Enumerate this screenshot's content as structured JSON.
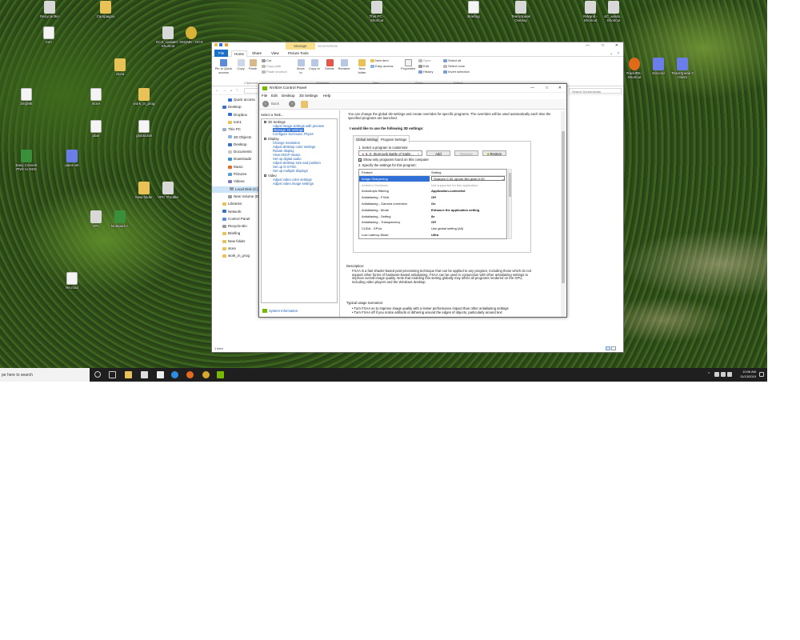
{
  "desktop": {
    "icons": [
      {
        "label": "Recycle Bin",
        "glyph": "g-app"
      },
      {
        "label": "Campaigns",
        "glyph": "g-folder"
      },
      {
        "label": "tom",
        "glyph": "g-doc"
      },
      {
        "label": "DCS_updater - Shortcut",
        "glyph": "g-app"
      },
      {
        "label": "3SQME - DCS",
        "glyph": "g-dcs"
      },
      {
        "label": "clcea",
        "glyph": "g-folder"
      },
      {
        "label": "3SQME",
        "glyph": "g-doc"
      },
      {
        "label": "store",
        "glyph": "g-doc"
      },
      {
        "label": "work_in_prog",
        "glyph": "g-folder"
      },
      {
        "label": "pbar",
        "glyph": "g-doc"
      },
      {
        "label": "globtodo8",
        "glyph": "g-doc"
      },
      {
        "label": "Easy Convert PNG to DDS",
        "glyph": "g-green"
      },
      {
        "label": "paint.net",
        "glyph": "g-blue"
      },
      {
        "label": "New folder",
        "glyph": "g-folder"
      },
      {
        "label": "VPC Throttle",
        "glyph": "g-app"
      },
      {
        "label": "VPC",
        "glyph": "g-app"
      },
      {
        "label": "Notepad++",
        "glyph": "g-green"
      },
      {
        "label": "Re.mod",
        "glyph": "g-doc"
      },
      {
        "label": "This PC - Shortcut",
        "glyph": "g-app"
      },
      {
        "label": "Briefing",
        "glyph": "g-doc"
      },
      {
        "label": "TeamSpeak Overlay",
        "glyph": "g-app"
      },
      {
        "label": "NWgrid - Shortcut",
        "glyph": "g-app"
      },
      {
        "label": "4C_windo... Shortcut",
        "glyph": "g-app"
      },
      {
        "label": "TrackIR5 - Shortcut",
        "glyph": "g-orange"
      },
      {
        "label": "Discord",
        "glyph": "g-blue"
      },
      {
        "label": "TeamSpeak 3 Client",
        "glyph": "g-blue"
      }
    ]
  },
  "taskbar": {
    "search_placeholder": "pe here to search",
    "time": "10:06 AM",
    "date": "11/13/2019"
  },
  "explorer": {
    "contextual_tab": "Manage",
    "window_title": "Screenshots",
    "tabs": {
      "file": "File",
      "home": "Home",
      "share": "Share",
      "view": "View",
      "picture_tools": "Picture Tools"
    },
    "ribbon": {
      "pin": "Pin to Quick access",
      "copy": "Copy",
      "paste": "Paste",
      "cut": "Cut",
      "copy_path": "Copy path",
      "paste_shortcut": "Paste shortcut",
      "move_to": "Move to",
      "copy_to": "Copy to",
      "delete": "Delete",
      "rename": "Rename",
      "new_folder": "New folder",
      "new_item": "New item",
      "easy_access": "Easy access",
      "properties": "Properties",
      "open": "Open",
      "edit": "Edit",
      "history": "History",
      "select_all": "Select all",
      "select_none": "Select none",
      "invert_selection": "Invert selection",
      "groups": {
        "clipboard": "Clipboard",
        "organize": "Organize",
        "new": "New",
        "open": "Open",
        "select": "Select"
      }
    },
    "search_placeholder": "Search Screenshots",
    "nav": [
      {
        "label": "Quick access"
      },
      {
        "label": "Desktop"
      },
      {
        "label": "Dropbox"
      },
      {
        "label": "tom1"
      },
      {
        "label": "This PC"
      },
      {
        "label": "3D Objects"
      },
      {
        "label": "Desktop"
      },
      {
        "label": "Documents"
      },
      {
        "label": "Downloads"
      },
      {
        "label": "Music"
      },
      {
        "label": "Pictures"
      },
      {
        "label": "Videos"
      },
      {
        "label": "Local Disk (C:)"
      },
      {
        "label": "New Volume (D:)"
      },
      {
        "label": "Libraries"
      },
      {
        "label": "Network"
      },
      {
        "label": "Control Panel"
      },
      {
        "label": "Recycle Bin"
      },
      {
        "label": "Briefing"
      },
      {
        "label": "New folder"
      },
      {
        "label": "store"
      },
      {
        "label": "work_in_prog"
      }
    ],
    "status": "1 item"
  },
  "nvcp": {
    "title": "NVIDIA Control Panel",
    "menu": {
      "file": "File",
      "edit": "Edit",
      "desktop": "Desktop",
      "settings_3d": "3D Settings",
      "help": "Help"
    },
    "back_label": "Back",
    "select_task": "Select a Task...",
    "tree": {
      "cat_3d": "3D Settings",
      "adjust_image": "Adjust image settings with preview",
      "manage_3d": "Manage 3D settings",
      "surround": "Configure Surround, PhysX",
      "cat_display": "Display",
      "change_res": "Change resolution",
      "adjust_color": "Adjust desktop color settings",
      "rotate": "Rotate display",
      "hdcp": "View HDCP status",
      "digital_audio": "Set up digital audio",
      "desktop_size": "Adjust desktop size and position",
      "gsync": "Set up G-SYNC",
      "multiple": "Set up multiple displays",
      "cat_video": "Video",
      "video_color": "Adjust video color settings",
      "video_image": "Adjust video image settings"
    },
    "system_info": "System Information",
    "intro": "You can change the global 3D settings and create overrides for specific programs. The overrides will be used automatically each time the specified programs are launched.",
    "want_title": "I would like to use the following 3D settings:",
    "tab_global": "Global Settings",
    "tab_program": "Program Settings",
    "step1": "1. Select a program to customize:",
    "program": "IL-2: Sturmovik Battle of Stalin...",
    "add": "Add",
    "remove": "Remove",
    "restore": "Restore",
    "only_found": "Show only programs found on this computer",
    "step2": "2. Specify the settings for this program:",
    "grid_header": {
      "feature": "Feature",
      "setting": "Setting"
    },
    "rows": [
      {
        "feature": "Image Sharpening",
        "setting": "Sharpen 0.30, ignore film grain 0.00"
      },
      {
        "feature": "Ambient Occlusion",
        "setting": "Not supported for this application"
      },
      {
        "feature": "Anisotropic filtering",
        "setting": "Application-controlled"
      },
      {
        "feature": "Antialiasing - FXAA",
        "setting": "Off"
      },
      {
        "feature": "Antialiasing - Gamma correction",
        "setting": "On"
      },
      {
        "feature": "Antialiasing - Mode",
        "setting": "Enhance the application setting"
      },
      {
        "feature": "Antialiasing - Setting",
        "setting": "8x"
      },
      {
        "feature": "Antialiasing - Transparency",
        "setting": "Off"
      },
      {
        "feature": "CUDA - GPUs",
        "setting": "Use global setting (All)"
      },
      {
        "feature": "Low Latency Mode",
        "setting": "Ultra"
      }
    ],
    "desc_hdr": "Description:",
    "desc": "FXAA is a fast shader-based post-processing technique that can be applied to any program, including those which do not support other forms of hardware-based antialiasing. FXAA can be used in conjunction with other antialiasing settings to improve overall image quality. Note that enabling this setting globally may affect all programs rendered on the GPU, including video players and the Windows desktop.",
    "usage_hdr": "Typical usage scenarios:",
    "usage_1": "• Turn FXAA on to improve image quality with a lesser performance impact than other antialiasing settings",
    "usage_2": "• Turn FXAA off if you notice artifacts or dithering around the edges of objects, particularly around text"
  }
}
